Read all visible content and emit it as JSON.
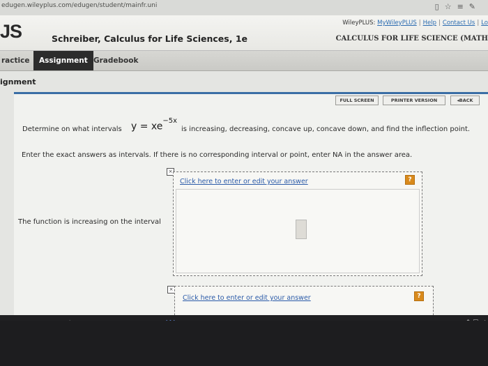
{
  "browser": {
    "url": "edugen.wileyplus.com/edugen/student/mainfr.uni",
    "icons": [
      "reading-view-icon",
      "favorite-star-icon",
      "hub-icon",
      "annotate-icon"
    ]
  },
  "header": {
    "logo": "JS",
    "course_title": "Schreiber, Calculus for Life Sciences, 1e",
    "top_links": [
      "WileyPLUS:",
      "MyWileyPLUS",
      "Help",
      "Contact Us",
      "Lo"
    ],
    "course_name_right": "CALCULUS FOR LIFE SCIENCE (MATH"
  },
  "nav": {
    "tabs": [
      {
        "label": "ractice"
      },
      {
        "label": "Assignment",
        "active": true
      },
      {
        "label": "Gradebook"
      }
    ]
  },
  "section": {
    "heading": "ignment"
  },
  "toolbar": {
    "full_screen": "FULL SCREEN",
    "printer_version": "PRINTER VERSION",
    "back": "BACK"
  },
  "question": {
    "prefix": "Determine on what intervals",
    "formula_base": "y = xe",
    "formula_exp": "−5x",
    "suffix": "is increasing, decreasing, concave up, concave down, and find the inflection point.",
    "instructions": "Enter the exact answers as intervals. If there is no corresponding interval or point, enter NA in the answer area.",
    "increasing_label": "The function is increasing on the interval"
  },
  "answer_area": {
    "edit_link": "Click here to enter or edit your answer",
    "help_mark": "?"
  },
  "taskbar": {
    "icons": [
      "microphone-icon",
      "task-view-icon",
      "file-explorer-icon",
      "edge-icon",
      "word-icon",
      "chrome-icon"
    ],
    "tray": "^ ☐ ◁"
  }
}
